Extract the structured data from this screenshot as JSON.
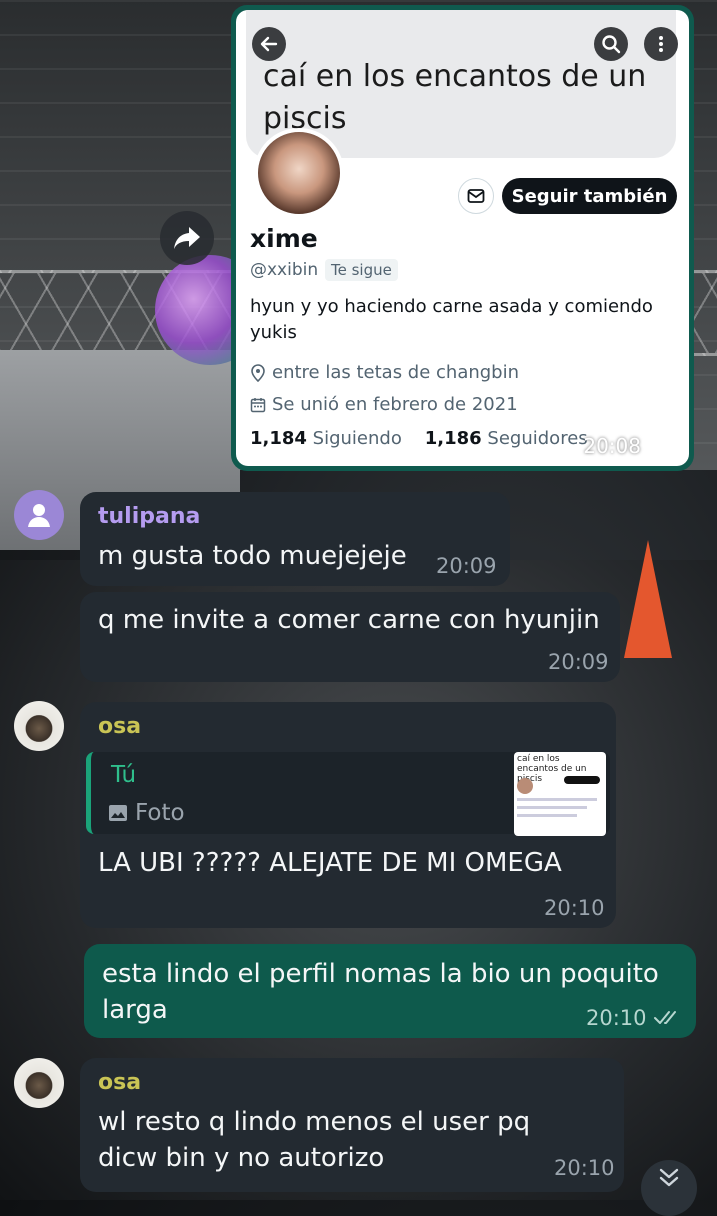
{
  "screenshot_card": {
    "header_text": "caí en los encantos de un piscis",
    "profile": {
      "name": "xime",
      "handle": "@xxibin",
      "follows_you_badge": "Te sigue",
      "follow_button_label": "Seguir también",
      "bio": "hyun y yo haciendo carne asada y comiendo yukis",
      "location": "entre las tetas de changbin",
      "joined": "Se unió en febrero de 2021",
      "following_count": "1,184",
      "following_label": "Siguiendo",
      "followers_count": "1,186",
      "followers_label": "Seguidores"
    },
    "time": "20:08"
  },
  "messages": [
    {
      "sender": "tulipana",
      "sender_color": "#b59cf0",
      "text": "m gusta todo muejejeje",
      "time": "20:09"
    },
    {
      "text": "q me invite a comer carne con hyunjin",
      "time": "20:09"
    },
    {
      "sender": "osa",
      "sender_color": "#c9c455",
      "reply_to": "Tú",
      "reply_type": "Foto",
      "reply_thumb_text": "caí en los encantos de un piscis",
      "text": "LA UBI ????? ALEJATE DE MI OMEGA",
      "time": "20:10"
    },
    {
      "outgoing": true,
      "text_line1": "esta lindo el perfil nomas la bio un poquito",
      "text_line2": "larga",
      "time": "20:10"
    },
    {
      "sender": "osa",
      "sender_color": "#c9c455",
      "text_line1": "wl resto q lindo menos el user pq",
      "text_line2": "dicw bin y no autorizo",
      "time": "20:10"
    }
  ],
  "icons": {
    "back": "arrow-left-icon",
    "search": "search-icon",
    "more": "more-vertical-icon",
    "mail": "mail-icon",
    "location": "location-pin-icon",
    "calendar": "calendar-icon",
    "forward": "forward-icon",
    "read_receipt": "double-check-icon",
    "scroll_down": "chevron-double-down-icon",
    "photo": "photo-icon",
    "default_avatar": "user-icon"
  }
}
